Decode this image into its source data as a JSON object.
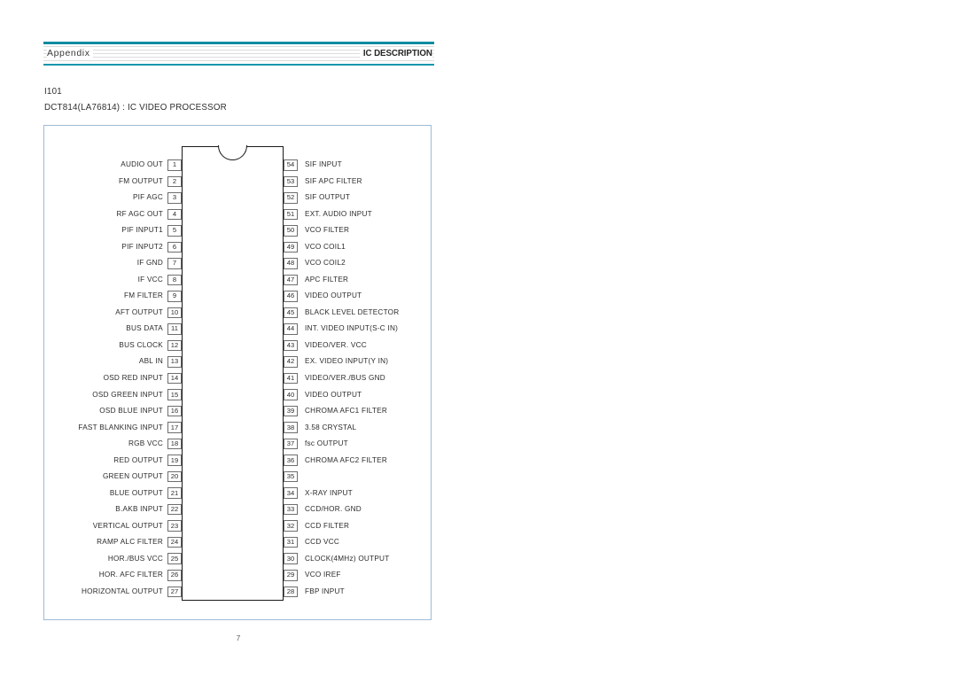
{
  "header": {
    "left_label": "Appendix",
    "right_label": "IC DESCRIPTION",
    "rule_color": "#1496ab"
  },
  "document": {
    "reference": "I101",
    "title": "DCT814(LA76814) : IC VIDEO PROCESSOR",
    "page_number": "7"
  },
  "diagram": {
    "frame_color": "#9dbbd6",
    "body_color": "#1a1a1a",
    "left_pins": [
      {
        "number": "1",
        "label": "AUDIO OUT"
      },
      {
        "number": "2",
        "label": "FM OUTPUT"
      },
      {
        "number": "3",
        "label": "PIF AGC"
      },
      {
        "number": "4",
        "label": "RF AGC OUT"
      },
      {
        "number": "5",
        "label": "PIF INPUT1"
      },
      {
        "number": "6",
        "label": "PIF INPUT2"
      },
      {
        "number": "7",
        "label": "IF GND"
      },
      {
        "number": "8",
        "label": "IF VCC"
      },
      {
        "number": "9",
        "label": "FM FILTER"
      },
      {
        "number": "10",
        "label": "AFT OUTPUT"
      },
      {
        "number": "11",
        "label": "BUS DATA"
      },
      {
        "number": "12",
        "label": "BUS CLOCK"
      },
      {
        "number": "13",
        "label": "ABL IN"
      },
      {
        "number": "14",
        "label": "OSD RED INPUT"
      },
      {
        "number": "15",
        "label": "OSD GREEN INPUT"
      },
      {
        "number": "16",
        "label": "OSD BLUE INPUT"
      },
      {
        "number": "17",
        "label": "FAST BLANKING INPUT"
      },
      {
        "number": "18",
        "label": "RGB VCC"
      },
      {
        "number": "19",
        "label": "RED OUTPUT"
      },
      {
        "number": "20",
        "label": "GREEN OUTPUT"
      },
      {
        "number": "21",
        "label": "BLUE OUTPUT"
      },
      {
        "number": "22",
        "label": "B.AKB INPUT"
      },
      {
        "number": "23",
        "label": "VERTICAL OUTPUT"
      },
      {
        "number": "24",
        "label": "RAMP ALC FILTER"
      },
      {
        "number": "25",
        "label": "HOR./BUS VCC"
      },
      {
        "number": "26",
        "label": "HOR. AFC FILTER"
      },
      {
        "number": "27",
        "label": "HORIZONTAL OUTPUT"
      }
    ],
    "right_pins": [
      {
        "number": "54",
        "label": "SIF INPUT"
      },
      {
        "number": "53",
        "label": "SIF APC FILTER"
      },
      {
        "number": "52",
        "label": "SIF OUTPUT"
      },
      {
        "number": "51",
        "label": "EXT. AUDIO INPUT"
      },
      {
        "number": "50",
        "label": "VCO FILTER"
      },
      {
        "number": "49",
        "label": "VCO COIL1"
      },
      {
        "number": "48",
        "label": "VCO COIL2"
      },
      {
        "number": "47",
        "label": "APC FILTER"
      },
      {
        "number": "46",
        "label": "VIDEO OUTPUT"
      },
      {
        "number": "45",
        "label": "BLACK LEVEL DETECTOR"
      },
      {
        "number": "44",
        "label": "INT. VIDEO INPUT(S-C IN)"
      },
      {
        "number": "43",
        "label": "VIDEO/VER. VCC"
      },
      {
        "number": "42",
        "label": "EX. VIDEO INPUT(Y IN)"
      },
      {
        "number": "41",
        "label": "VIDEO/VER./BUS GND"
      },
      {
        "number": "40",
        "label": "VIDEO OUTPUT"
      },
      {
        "number": "39",
        "label": "CHROMA AFC1 FILTER"
      },
      {
        "number": "38",
        "label": "3.58 CRYSTAL"
      },
      {
        "number": "37",
        "label": "fsc OUTPUT"
      },
      {
        "number": "36",
        "label": "CHROMA AFC2 FILTER"
      },
      {
        "number": "35",
        "label": ""
      },
      {
        "number": "34",
        "label": "X-RAY INPUT"
      },
      {
        "number": "33",
        "label": "CCD/HOR. GND"
      },
      {
        "number": "32",
        "label": "CCD FILTER"
      },
      {
        "number": "31",
        "label": "CCD VCC"
      },
      {
        "number": "30",
        "label": "CLOCK(4MHz) OUTPUT"
      },
      {
        "number": "29",
        "label": "VCO IREF"
      },
      {
        "number": "28",
        "label": "FBP INPUT"
      }
    ]
  }
}
